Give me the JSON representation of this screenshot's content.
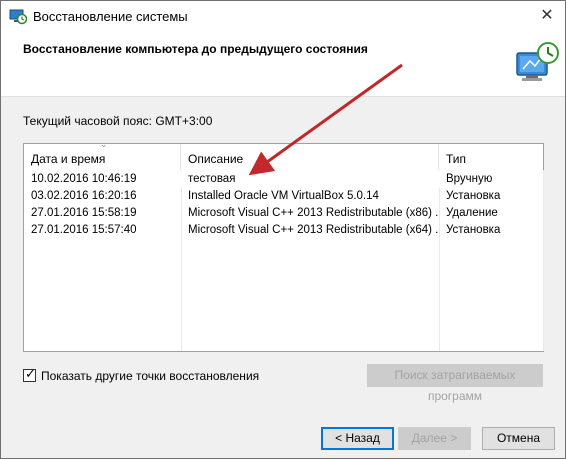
{
  "window": {
    "title": "Восстановление системы",
    "close_glyph": "✕",
    "icon": "system-restore-icon"
  },
  "header": {
    "heading": "Восстановление компьютера до предыдущего состояния",
    "icon": "computer-restore-clock-icon"
  },
  "timezone_label": "Текущий часовой пояс: GMT+3:00",
  "table": {
    "columns": [
      "Дата и время",
      "Описание",
      "Тип"
    ],
    "rows": [
      {
        "date": "10.02.2016 10:46:19",
        "description": "тестовая",
        "type": "Вручную"
      },
      {
        "date": "03.02.2016 16:20:16",
        "description": "Installed Oracle VM VirtualBox 5.0.14",
        "type": "Установка"
      },
      {
        "date": "27.01.2016 15:58:19",
        "description": "Microsoft Visual C++ 2013 Redistributable (x86) ...",
        "type": "Удаление"
      },
      {
        "date": "27.01.2016 15:57:40",
        "description": "Microsoft Visual C++ 2013 Redistributable (x64) ...",
        "type": "Установка"
      }
    ]
  },
  "show_more": {
    "label": "Показать другие точки восстановления",
    "checked": true
  },
  "buttons": {
    "scan": "Поиск затрагиваемых программ",
    "back": "< Назад",
    "next": "Далее >",
    "cancel": "Отмена"
  },
  "colors": {
    "annotation_arrow": "#c0282a",
    "accent": "#0078d7"
  }
}
